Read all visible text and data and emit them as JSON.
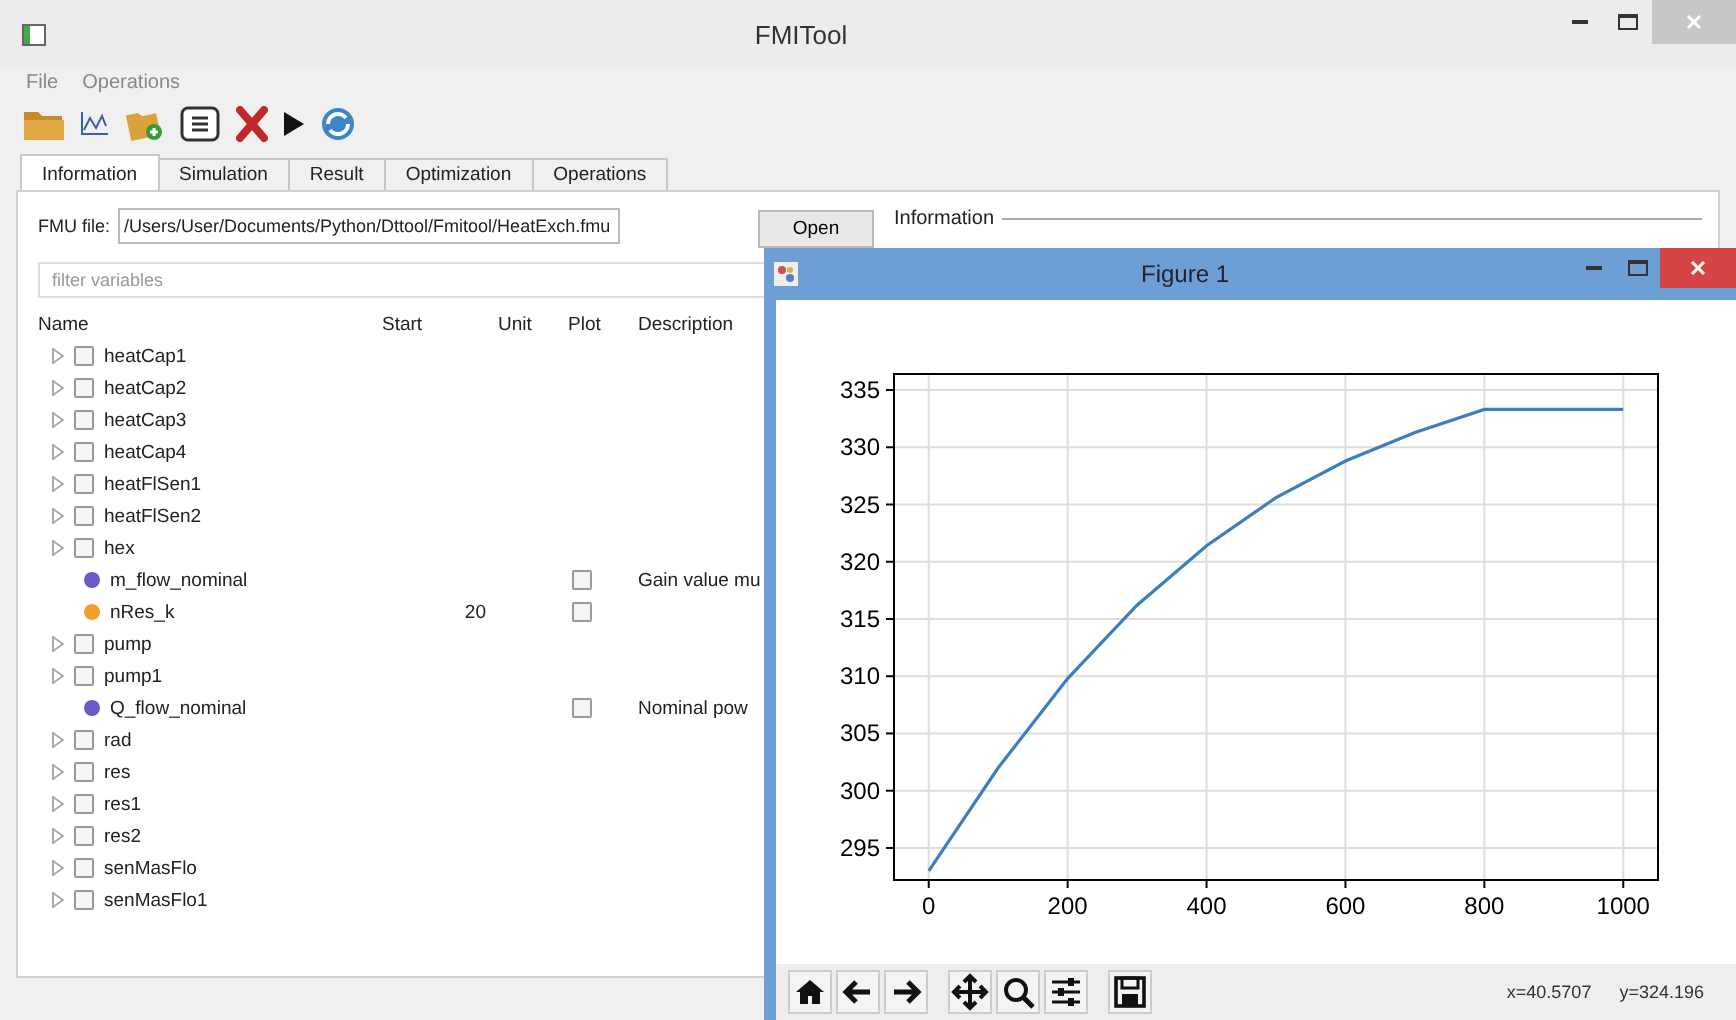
{
  "window": {
    "title": "FMITool"
  },
  "menu": [
    "File",
    "Operations"
  ],
  "tabs": [
    {
      "label": "Information",
      "selected": true
    },
    {
      "label": "Simulation",
      "selected": false
    },
    {
      "label": "Result",
      "selected": false
    },
    {
      "label": "Optimization",
      "selected": false
    },
    {
      "label": "Operations",
      "selected": false
    }
  ],
  "fmu_file": {
    "label": "FMU file:",
    "value": "/Users/User/Documents/Python/Dttool/Fmitool/HeatExch.fmu"
  },
  "open_button": "Open",
  "information_group": {
    "title": "Information"
  },
  "filter": {
    "placeholder": "filter variables"
  },
  "variables": {
    "columns": [
      "Name",
      "Start",
      "Unit",
      "Plot",
      "Description"
    ],
    "rows": [
      {
        "kind": "group",
        "name": "heatCap1",
        "checked": false
      },
      {
        "kind": "group",
        "name": "heatCap2",
        "checked": false
      },
      {
        "kind": "group",
        "name": "heatCap3",
        "checked": false
      },
      {
        "kind": "group",
        "name": "heatCap4",
        "checked": false
      },
      {
        "kind": "group",
        "name": "heatFlSen1",
        "checked": false
      },
      {
        "kind": "group",
        "name": "heatFlSen2",
        "checked": false
      },
      {
        "kind": "group",
        "name": "hex",
        "checked": false
      },
      {
        "kind": "variable",
        "name": "m_flow_nominal",
        "color": "#6a5acd",
        "plot": false,
        "description": "Gain value mu"
      },
      {
        "kind": "variable",
        "name": "nRes_k",
        "color": "#f0a030",
        "start": "20",
        "plot": false
      },
      {
        "kind": "group",
        "name": "pump",
        "checked": false
      },
      {
        "kind": "group",
        "name": "pump1",
        "checked": false
      },
      {
        "kind": "variable",
        "name": "Q_flow_nominal",
        "color": "#6a5acd",
        "plot": false,
        "description": "Nominal pow"
      },
      {
        "kind": "group",
        "name": "rad",
        "checked": false
      },
      {
        "kind": "group",
        "name": "res",
        "checked": false
      },
      {
        "kind": "group",
        "name": "res1",
        "checked": false
      },
      {
        "kind": "group",
        "name": "res2",
        "checked": false
      },
      {
        "kind": "group",
        "name": "senMasFlo",
        "checked": false
      },
      {
        "kind": "group",
        "name": "senMasFlo1",
        "checked": false
      }
    ]
  },
  "figure": {
    "title": "Figure 1",
    "chart_data": {
      "type": "line",
      "x": [
        0,
        100,
        200,
        300,
        400,
        500,
        600,
        700,
        800,
        900,
        1000
      ],
      "grid": true,
      "series": [
        {
          "color": "#3c7fc0",
          "values": [
            293,
            302,
            309.8,
            316.2,
            321.4,
            325.6,
            328.8,
            331.3,
            333.3,
            333.3,
            333.3
          ]
        }
      ],
      "xlim": [
        -50,
        1050
      ],
      "ylim": [
        292.2,
        336.4
      ],
      "xticks": [
        0,
        200,
        400,
        600,
        800,
        1000
      ],
      "yticks": [
        295,
        300,
        305,
        310,
        315,
        320,
        325,
        330,
        335
      ]
    },
    "coordinates": {
      "x": "x=40.5707",
      "y": "y=324.196"
    }
  }
}
